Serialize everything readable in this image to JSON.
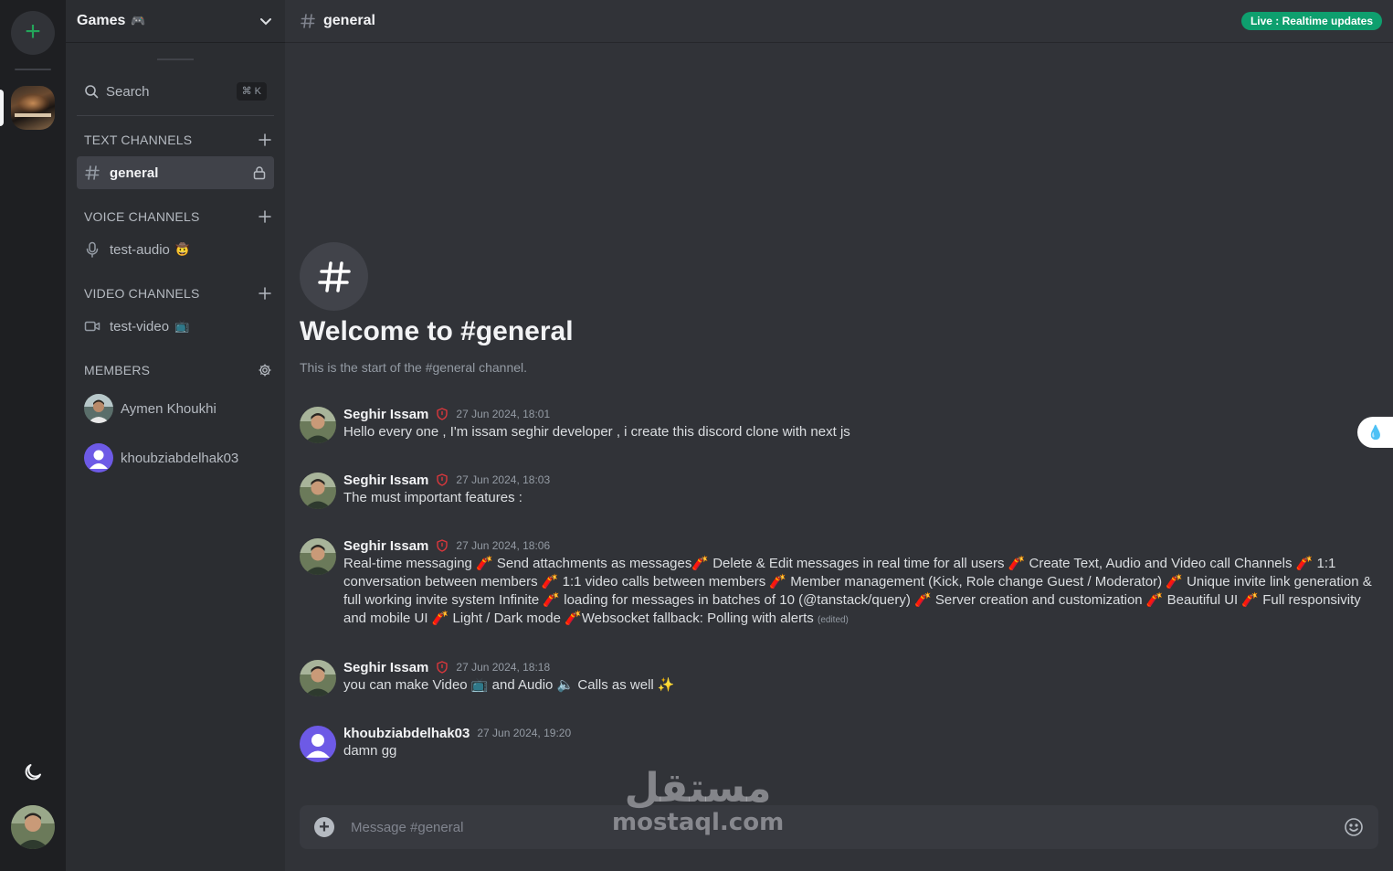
{
  "colors": {
    "rail_bg": "#1e1f22",
    "sidebar_bg": "#2b2d31",
    "main_bg": "#313338",
    "accent_green": "#23a55a",
    "live_badge": "#0e9f6e",
    "shield_red": "#da373c",
    "member_purple": "#5865f2"
  },
  "rail": {
    "add_server_icon": "plus-icon",
    "theme_icon": "moon-icon"
  },
  "sidebar": {
    "server_name": "Games",
    "server_emoji": "🎮",
    "search": {
      "label": "Search",
      "shortcut": "⌘ K"
    },
    "sections": {
      "text": {
        "title": "TEXT CHANNELS"
      },
      "voice": {
        "title": "VOICE CHANNELS"
      },
      "video": {
        "title": "VIDEO CHANNELS"
      },
      "members": {
        "title": "MEMBERS"
      }
    },
    "channels": {
      "text": [
        {
          "name": "general",
          "icon": "hash-icon",
          "locked": true
        }
      ],
      "voice": [
        {
          "name": "test-audio",
          "emoji": "🤠",
          "icon": "mic-icon"
        }
      ],
      "video": [
        {
          "name": "test-video",
          "emoji": "📺",
          "icon": "video-icon"
        }
      ]
    },
    "members": [
      {
        "name": "Aymen Khoukhi"
      },
      {
        "name": "khoubziabdelhak03"
      }
    ]
  },
  "header": {
    "channel": "general",
    "badge": "Live : Realtime updates"
  },
  "welcome": {
    "title": "Welcome to #general",
    "subtitle": "This is the start of the #general channel."
  },
  "messages": [
    {
      "author": "Seghir Issam",
      "time": "27 Jun 2024, 18:01",
      "text": "Hello every one , I'm issam seghir developer , i create this discord clone with next js"
    },
    {
      "author": "Seghir Issam",
      "time": "27 Jun 2024, 18:03",
      "text": "The must important features :"
    },
    {
      "author": "Seghir Issam",
      "time": "27 Jun 2024, 18:06",
      "text": "Real-time messaging 🧨 Send attachments as messages🧨 Delete & Edit messages in real time for all users 🧨 Create Text, Audio and Video call Channels 🧨 1:1 conversation between members 🧨 1:1 video calls between members 🧨 Member management (Kick, Role change Guest / Moderator) 🧨 Unique invite link generation & full working invite system Infinite 🧨 loading for messages in batches of 10 (@tanstack/query) 🧨 Server creation and customization 🧨 Beautiful UI 🧨 Full responsivity and mobile UI 🧨 Light / Dark mode 🧨Websocket fallback: Polling with alerts",
      "edited": "(edited)"
    },
    {
      "author": "Seghir Issam",
      "time": "27 Jun 2024, 18:18",
      "text": "you can make Video 📺 and Audio 🔈 Calls as well ✨"
    },
    {
      "author": "khoubziabdelhak03",
      "time": "27 Jun 2024, 19:20",
      "text": "damn gg"
    }
  ],
  "composer": {
    "placeholder": "Message #general"
  },
  "watermark": {
    "arabic": "مستقل",
    "latin": "mostaql.com"
  }
}
